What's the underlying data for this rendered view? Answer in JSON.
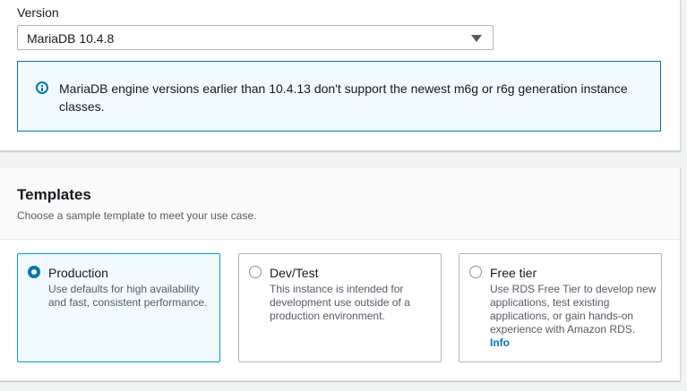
{
  "version": {
    "label": "Version",
    "selected": "MariaDB 10.4.8"
  },
  "alert": {
    "icon": "info-icon",
    "text": "MariaDB engine versions earlier than 10.4.13 don't support the newest m6g or r6g generation instance classes."
  },
  "templates": {
    "title": "Templates",
    "description": "Choose a sample template to meet your use case.",
    "options": [
      {
        "title": "Production",
        "description": "Use defaults for high availability and fast, consistent performance.",
        "selected": true
      },
      {
        "title": "Dev/Test",
        "description": "This instance is intended for development use outside of a production environment.",
        "selected": false
      },
      {
        "title": "Free tier",
        "description": "Use RDS Free Tier to develop new applications, test existing applications, or gain hands-on experience with Amazon RDS.",
        "link": "Info",
        "selected": false
      }
    ]
  },
  "colors": {
    "accent": "#0073bb",
    "selected_border": "#00a1c9",
    "selected_bg": "#f1faff"
  }
}
